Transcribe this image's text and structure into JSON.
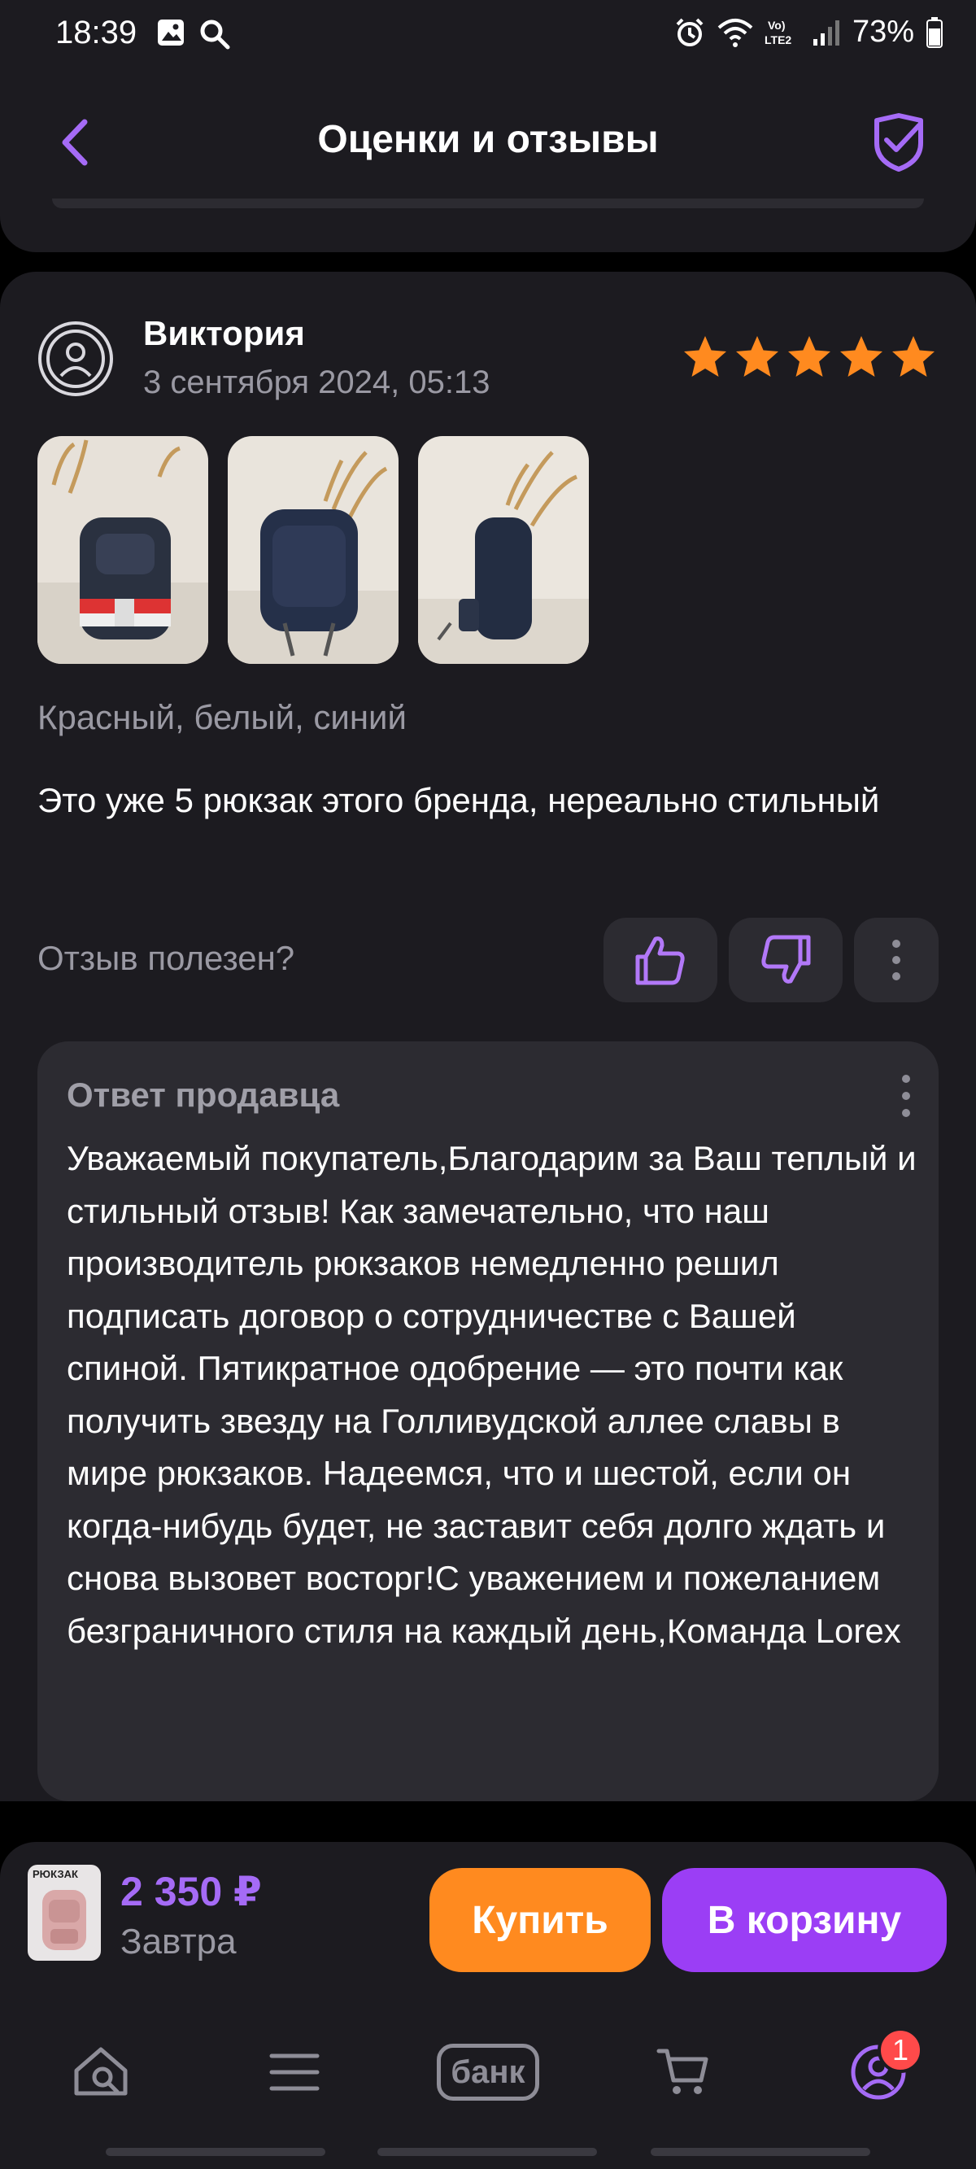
{
  "status_bar": {
    "time": "18:39",
    "battery": "73%"
  },
  "header": {
    "title": "Оценки и отзывы"
  },
  "review": {
    "author": "Виктория",
    "date": "3 сентября 2024, 05:13",
    "rating": 5,
    "variant": "Красный, белый, синий",
    "text": "Это уже 5 рюкзак этого бренда, нереально стильный",
    "helpful_label": "Отзыв полезен?"
  },
  "seller_reply": {
    "title": "Ответ продавца",
    "text": "Уважаемый покупатель,Благодарим за Ваш теплый и стильный отзыв! Как замечательно, что наш производитель рюкзаков немедленно решил подписать договор о сотрудничестве с Вашей спиной. Пятикратное одобрение — это почти как получить звезду на Голливудской аллее славы в мире рюкзаков. Надеемся, что и шестой, если он когда-нибудь будет, не заставит себя долго ждать и снова вызовет восторг!С уважением и пожеланием безграничного стиля на каждый день,Команда Lorex"
  },
  "buy_bar": {
    "thumb_label": "РЮКЗАК",
    "price": "2 350 ₽",
    "delivery": "Завтра",
    "buy_label": "Купить",
    "cart_label": "В корзину"
  },
  "bottom_nav": {
    "bank_label": "банк",
    "profile_badge": "1"
  },
  "colors": {
    "accent": "#9b3ef5",
    "price": "#a56bf6",
    "buy": "#ff8a1f",
    "star": "#ff8a1f",
    "badge": "#ff4a4a"
  }
}
